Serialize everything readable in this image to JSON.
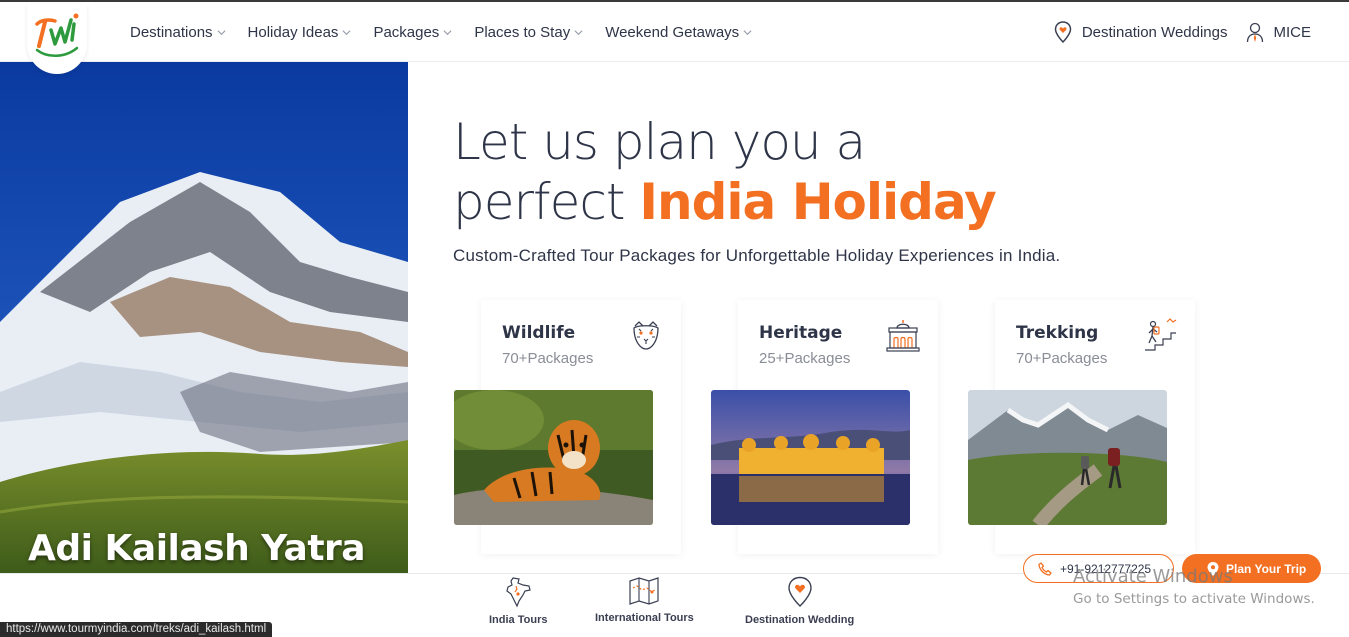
{
  "header": {
    "nav": [
      {
        "label": "Destinations"
      },
      {
        "label": "Holiday Ideas"
      },
      {
        "label": "Packages"
      },
      {
        "label": "Places to Stay"
      },
      {
        "label": "Weekend Getaways"
      }
    ],
    "right": [
      {
        "label": "Destination Weddings",
        "icon": "location-heart-icon"
      },
      {
        "label": "MICE",
        "icon": "person-icon"
      }
    ]
  },
  "hero": {
    "caption": "Adi Kailash Yatra",
    "headline_line1": "Let us plan you a",
    "headline_prefix": "perfect",
    "headline_accent": "India Holiday",
    "subline": "Custom-Crafted Tour Packages for Unforgettable Holiday Experiences in India."
  },
  "cards": [
    {
      "title": "Wildlife",
      "count": "70+Packages",
      "icon": "tiger-icon"
    },
    {
      "title": "Heritage",
      "count": "25+Packages",
      "icon": "palace-icon"
    },
    {
      "title": "Trekking",
      "count": "70+Packages",
      "icon": "hiker-icon"
    }
  ],
  "bottom_nav": [
    {
      "label": "India Tours",
      "icon": "india-map-icon"
    },
    {
      "label": "International Tours",
      "icon": "world-map-icon"
    },
    {
      "label": "Destination Wedding",
      "icon": "location-heart-icon"
    }
  ],
  "contact": {
    "phone": "+91-9212777225",
    "plan_label": "Plan Your Trip"
  },
  "watermark": {
    "line1": "Activate Windows",
    "line2": "Go to Settings to activate Windows."
  },
  "status_url": "https://www.tourmyindia.com/treks/adi_kailash.html",
  "colors": {
    "accent": "#f36f21",
    "text": "#2f3548",
    "muted": "#8a8d96"
  }
}
